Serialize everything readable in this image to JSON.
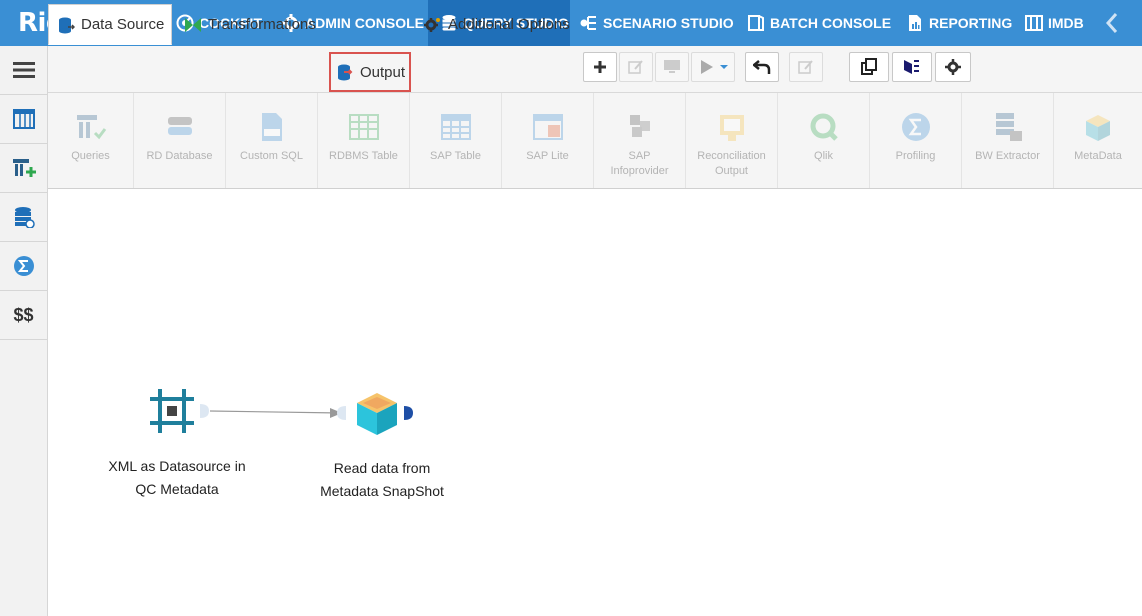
{
  "brand": {
    "logo_text": "RightData"
  },
  "nav": {
    "items": [
      {
        "label": "COCKPIT",
        "icon": "cockpit-icon"
      },
      {
        "label": "ADMIN CONSOLE",
        "icon": "gear-icon"
      },
      {
        "label": "QUERY STUDIO",
        "icon": "database-icon",
        "active": true
      },
      {
        "label": "SCENARIO STUDIO",
        "icon": "scenario-icon"
      },
      {
        "label": "BATCH CONSOLE",
        "icon": "batch-icon"
      },
      {
        "label": "REPORTING",
        "icon": "report-icon"
      },
      {
        "label": "IMDB",
        "icon": "imdb-icon"
      }
    ]
  },
  "sidebar": {
    "items": [
      {
        "icon": "menu-icon"
      },
      {
        "icon": "table-icon"
      },
      {
        "icon": "table-add-icon"
      },
      {
        "icon": "database-icon"
      },
      {
        "icon": "sigma-icon"
      },
      {
        "label": "$$",
        "icon": "dollar-icon"
      }
    ]
  },
  "tabs": [
    {
      "label": "Data Source",
      "icon": "datasource-icon",
      "active": true
    },
    {
      "label": "Transformations",
      "icon": "transform-icon"
    },
    {
      "label": "Output",
      "icon": "output-icon",
      "highlighted": true
    },
    {
      "label": "Additional Options",
      "icon": "gears-icon"
    }
  ],
  "toolbar": {
    "buttons": [
      {
        "name": "add",
        "icon": "plus-icon",
        "enabled": true
      },
      {
        "name": "edit",
        "icon": "edit-icon",
        "enabled": false
      },
      {
        "name": "monitor",
        "icon": "monitor-icon",
        "enabled": false
      },
      {
        "name": "run",
        "icon": "play-icon",
        "enabled": false
      },
      {
        "name": "undo",
        "icon": "undo-icon",
        "enabled": true
      },
      {
        "name": "edit-note",
        "icon": "edit-icon",
        "enabled": false
      },
      {
        "name": "copy",
        "icon": "copy-icon",
        "enabled": true
      },
      {
        "name": "layout",
        "icon": "layout-icon",
        "enabled": true
      },
      {
        "name": "settings",
        "icon": "gear-icon",
        "enabled": true
      }
    ]
  },
  "ribbon": {
    "items": [
      {
        "label": "Queries"
      },
      {
        "label": "RD Database"
      },
      {
        "label": "Custom SQL"
      },
      {
        "label": "RDBMS Table"
      },
      {
        "label": "SAP Table"
      },
      {
        "label": "SAP Lite"
      },
      {
        "label": "SAP\nInfoprovider"
      },
      {
        "label": "Reconciliation\nOutput"
      },
      {
        "label": "Qlik"
      },
      {
        "label": "Profiling"
      },
      {
        "label": "BW Extractor"
      },
      {
        "label": "MetaData"
      }
    ]
  },
  "canvas": {
    "nodes": [
      {
        "label_line1": "XML as Datasource in",
        "label_line2": "QC Metadata",
        "icon": "frame-icon"
      },
      {
        "label_line1": "Read data from",
        "label_line2": "Metadata SnapShot",
        "icon": "box-icon"
      }
    ]
  },
  "colors": {
    "nav_bg": "#3a8fd4",
    "nav_active": "#1f6fb8",
    "node_teal": "#1f7f9c",
    "highlight_border": "#d9534f"
  }
}
